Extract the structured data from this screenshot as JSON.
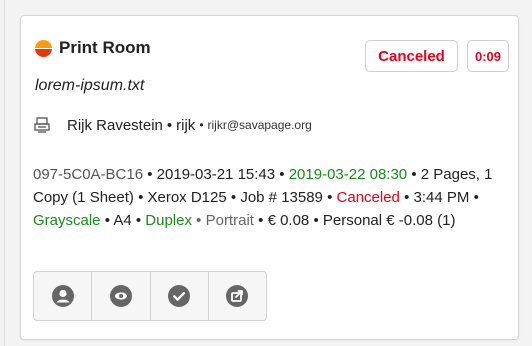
{
  "card": {
    "title": "Print Room",
    "filename": "lorem-ipsum.txt",
    "status_badge": "Canceled",
    "time_badge": "0:09"
  },
  "user": {
    "name": "Rijk Ravestein",
    "id": "rijk",
    "email": "rijkr@savapage.org"
  },
  "details": {
    "job_ref": "097-5C0A-BC16",
    "created": "2019-03-21 15:43",
    "expiry": "2019-03-22 08:30",
    "pages": "2 Pages, 1 Copy (1 Sheet)",
    "printer": "Xerox D125",
    "job_number": "Job # 13589",
    "state": "Canceled",
    "state_time": "3:44 PM",
    "color_mode": "Grayscale",
    "paper": "A4",
    "duplex": "Duplex",
    "orientation": "Portrait",
    "cost": "€ 0.08",
    "account": "Personal € -0.08 (1)"
  },
  "separator": "•",
  "icons": [
    "user-icon",
    "eye-icon",
    "check-icon",
    "share-icon"
  ],
  "colors": {
    "green": "#1a8a1a",
    "red": "#e8001c",
    "status_dot_top": "#f39c12",
    "status_dot_bottom": "#e8380d"
  }
}
